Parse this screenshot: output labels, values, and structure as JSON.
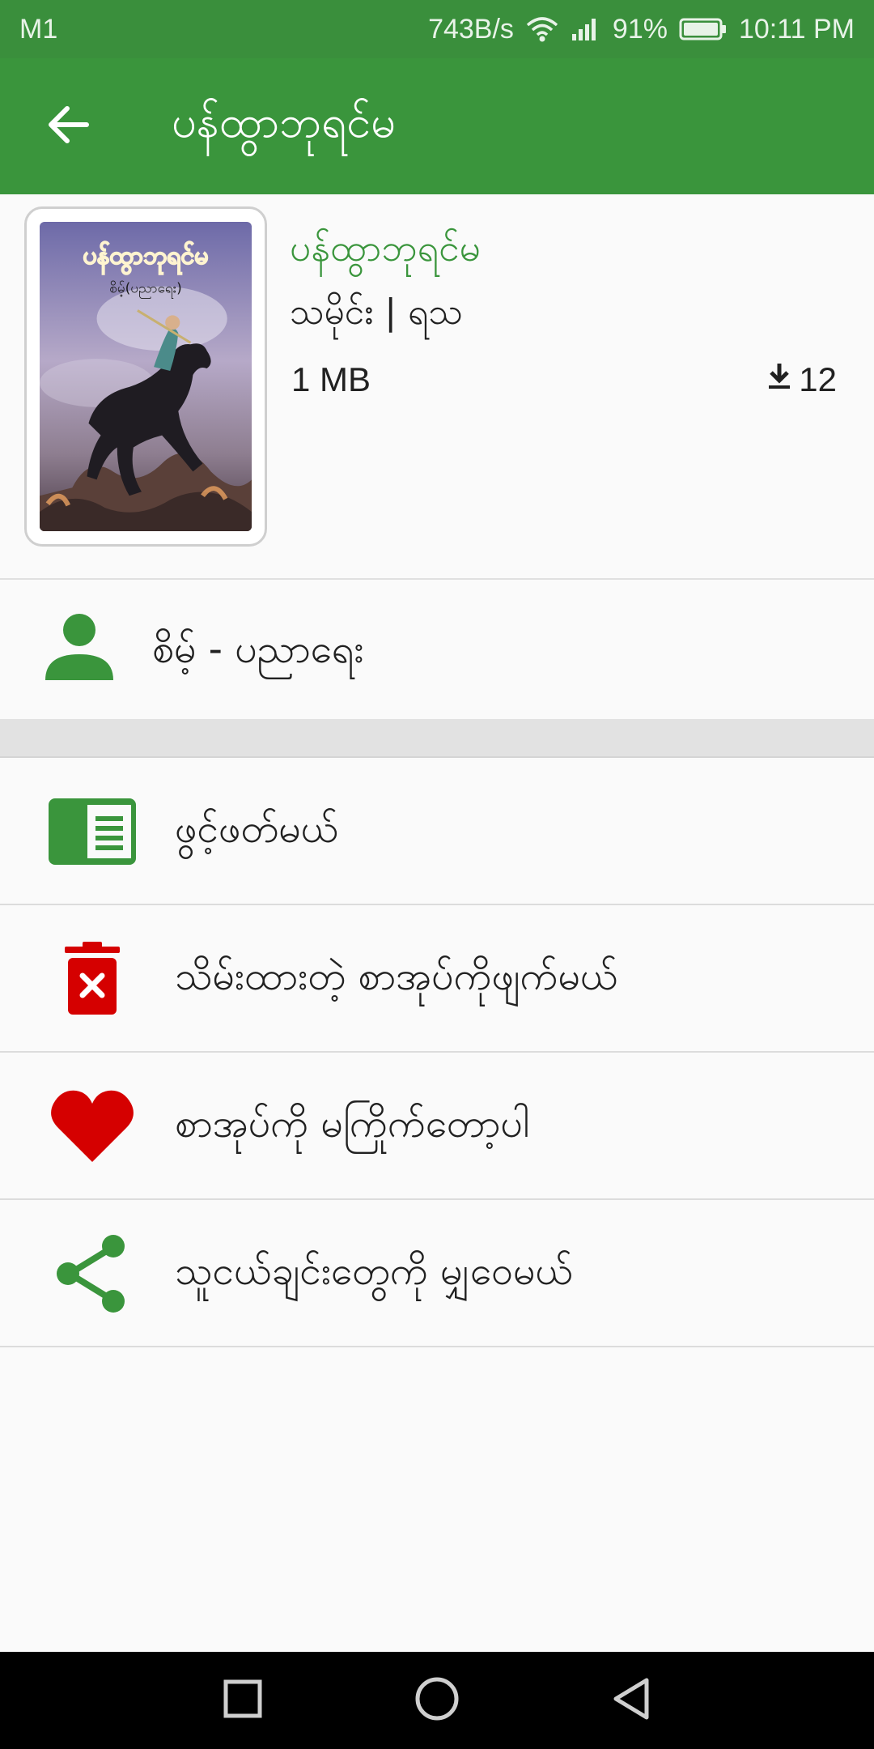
{
  "status_bar": {
    "carrier": "M1",
    "speed": "743B/s",
    "battery": "91%",
    "time": "10:11 PM"
  },
  "toolbar": {
    "title": "ပန်ထွာဘုရင်မ",
    "back_icon": "arrow-left-icon"
  },
  "book": {
    "title": "ပန်ထွာဘုရင်မ",
    "meta": "သမိုင်း | ရသ",
    "size": "1 MB",
    "downloads": "12",
    "cover_title": "ပန်ထွာဘုရင်မ",
    "cover_author": "စိမ့်(ပညာရေး)"
  },
  "author": {
    "name": "စိမ့် - ပညာရေး",
    "icon": "person-icon"
  },
  "actions": [
    {
      "label": "ဖွင့်ဖတ်မယ်",
      "icon": "book-open-icon",
      "color": "#3a953c"
    },
    {
      "label": "သိမ်းထားတဲ့ စာအုပ်ကိုဖျက်မယ်",
      "icon": "trash-icon",
      "color": "#d50000"
    },
    {
      "label": "စာအုပ်ကို မကြိုက်တော့ပါ",
      "icon": "heart-icon",
      "color": "#d50000"
    },
    {
      "label": "သူငယ်ချင်းတွေကို မျှဝေမယ်",
      "icon": "share-icon",
      "color": "#3a953c"
    }
  ],
  "colors": {
    "primary": "#3a953c",
    "danger": "#d50000"
  }
}
